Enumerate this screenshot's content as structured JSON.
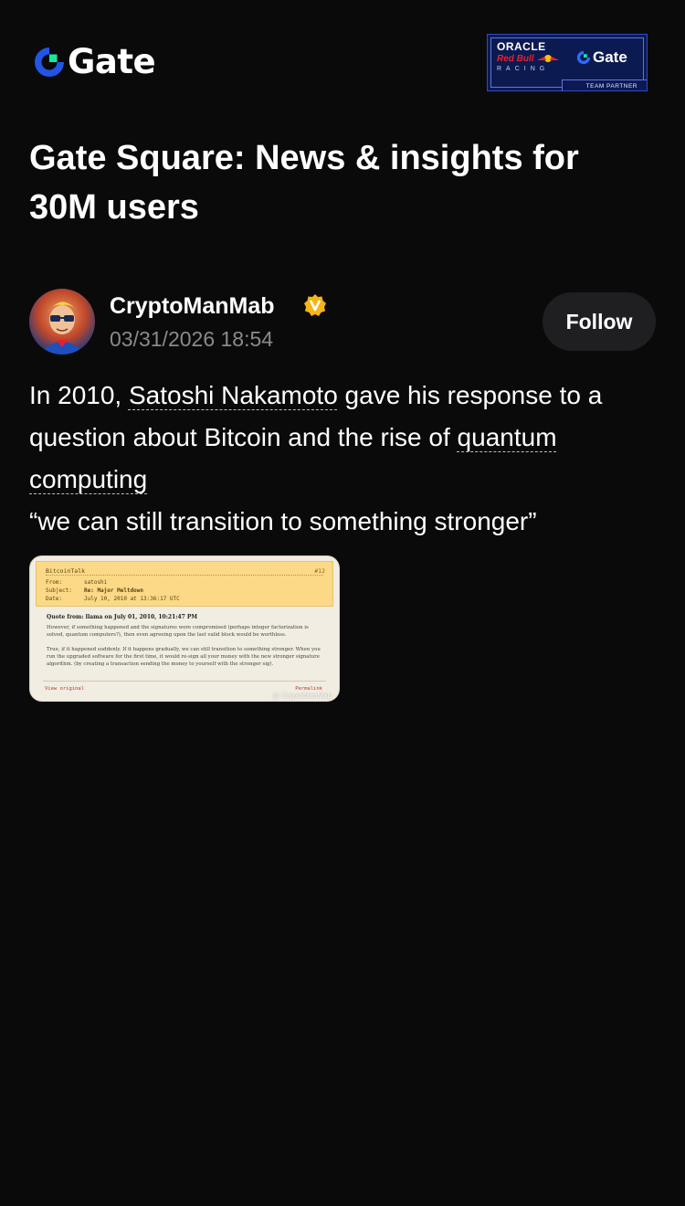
{
  "header": {
    "brand": "Gate",
    "partner_badge": {
      "oracle": "ORACLE",
      "redbull": "Red Bull",
      "racing": "RACING",
      "gate": "Gate",
      "strip": "TEAM PARTNER"
    }
  },
  "page_title": "Gate Square: News & insights for 30M users",
  "post": {
    "author": {
      "name": "CryptoManMab",
      "verified_icon": "verified-v-badge",
      "date": "03/31/2026 18:54",
      "follow_label": "Follow"
    },
    "body": {
      "text_1": "In 2010, ",
      "tag_1": "Satoshi Nakamoto",
      "text_2": " gave his response to a question about Bitcoin and the rise of ",
      "tag_2": "quantum computing",
      "quote": "“we can still transition to something stronger”"
    },
    "image": {
      "forum": "BitcoinTalk",
      "number": "#12",
      "from_label": "From:",
      "from_value": "satoshi",
      "subject_label": "Subject:",
      "subject_value": "Re: Major Meltdown",
      "date_label": "Date:",
      "date_value": "July 10, 2010 at 13:36:17 UTC",
      "quote_head": "Quote from: llama on July 01, 2010, 10:21:47 PM",
      "quote_text": "However, if something happened and the signatures were compromised (perhaps integer factorization is solved, quantum computers?), then even agreeing upon the last valid block would be worthless.",
      "reply_text": "True, if it happened suddenly. If it happens gradually, we can still transition to something stronger. When you run the upgraded software for the first time, it would re-sign all your money with the new stronger signature algorithm. (by creating a transaction sending the money to yourself with the stronger sig).",
      "view_original": "View original",
      "permalink": "Permalink",
      "watermark": "@ CryptoManMab"
    }
  },
  "colors": {
    "background": "#0a0a0b",
    "muted_text": "#8a8a8e",
    "follow_bg": "#1f1f21",
    "verified": "#f5b417",
    "brand_blue": "#2354e6",
    "brand_green": "#17e6a1"
  }
}
